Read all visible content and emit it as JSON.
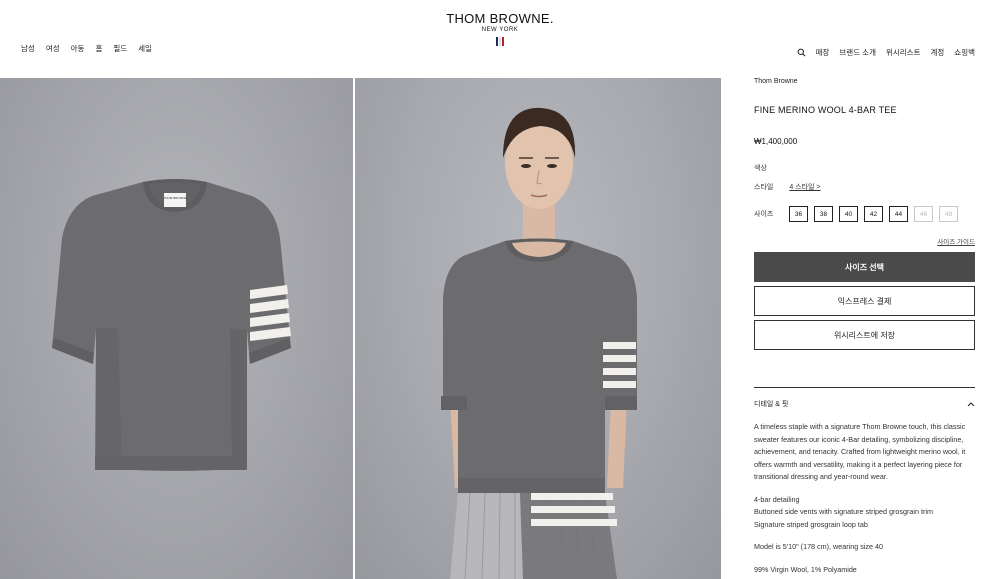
{
  "header": {
    "logo_main": "THOM BROWNE.",
    "logo_sub": "NEW YORK",
    "nav_left": [
      "남성",
      "여성",
      "아동",
      "홈",
      "필드",
      "세일"
    ],
    "nav_right": [
      "매장",
      "브랜드 소개",
      "위시리스트",
      "계정",
      "쇼핑백"
    ],
    "flag_colors": [
      "#1d2b5c",
      "#ffffff",
      "#b22234"
    ]
  },
  "product": {
    "brand": "Thom Browne",
    "name": "FINE MERINO WOOL 4-BAR TEE",
    "price": "₩1,400,000",
    "color_label": "색상",
    "style_label": "스타일",
    "style_value": "4 스타일  >",
    "size_label": "사이즈",
    "sizes": [
      {
        "label": "36",
        "available": true
      },
      {
        "label": "38",
        "available": true
      },
      {
        "label": "40",
        "available": true
      },
      {
        "label": "42",
        "available": true
      },
      {
        "label": "44",
        "available": true
      },
      {
        "label": "46",
        "available": false
      },
      {
        "label": "48",
        "available": false
      }
    ],
    "size_guide": "사이즈 가이드",
    "select_size_button": "사이즈 선택",
    "express_checkout_button": "익스프레스 결제",
    "wishlist_button": "위시리스트에 저장"
  },
  "details": {
    "title": "디테일 & 핏",
    "description": "A timeless staple with a signature Thom Browne touch, this classic sweater features our iconic 4-Bar detailing, symbolizing discipline, achievement, and tenacity. Crafted from lightweight merino wool, it offers warmth and versatility, making it a perfect layering piece for transitional dressing and year-round wear.",
    "features": [
      "4-bar detailing",
      "Buttoned side vents with signature striped grosgrain trim",
      "Signature striped grosgrain loop tab"
    ],
    "model_info": "Model is 5'10\" (178 cm), wearing size 40",
    "composition": "99% Virgin Wool, 1% Polyamide"
  },
  "images": {
    "colors": {
      "sweater": "#6b6b6d",
      "sweater_dark": "#5c5c5e",
      "stripe": "#f1f0ec",
      "background": "#a8a9ae"
    }
  }
}
